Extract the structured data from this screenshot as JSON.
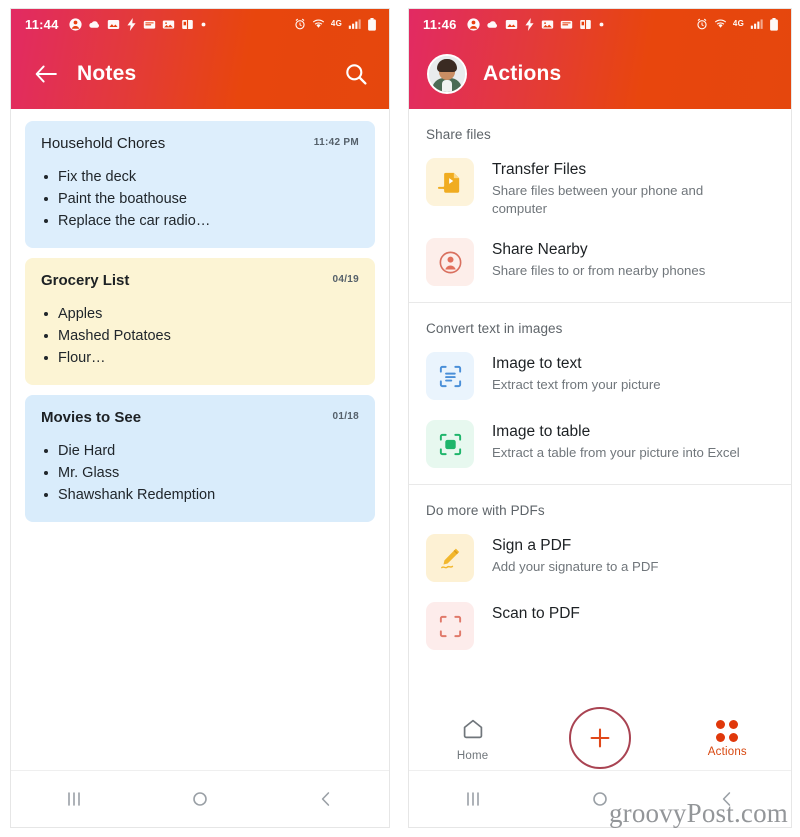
{
  "notes_panel": {
    "status_bar": {
      "clock": "11:44",
      "icons": [
        "account-icon",
        "weather-icon",
        "photos-icon",
        "flash-icon",
        "message-icon",
        "gallery-icon",
        "book-icon",
        "dot-icon"
      ],
      "right_icons": [
        "alarm-icon",
        "wifi-icon",
        "network-speed-icon",
        "signal-icon",
        "battery-icon"
      ]
    },
    "app_bar": {
      "back_label": "back-arrow",
      "title": "Notes",
      "search_label": "search"
    },
    "notes": [
      {
        "title": "Household Chores",
        "date": "11:42 PM",
        "bold": false,
        "bg": "#ddeefc",
        "items": [
          "Fix the deck",
          "Paint the boathouse",
          "Replace the car radio…"
        ]
      },
      {
        "title": "Grocery List",
        "date": "04/19",
        "bold": true,
        "bg": "#fcf4d4",
        "items": [
          "Apples",
          "Mashed Potatoes",
          "Flour…"
        ]
      },
      {
        "title": "Movies to See",
        "date": "01/18",
        "bold": true,
        "bg": "#d9ecfb",
        "items": [
          "Die Hard",
          "Mr. Glass",
          "Shawshank Redemption"
        ]
      }
    ]
  },
  "actions_panel": {
    "status_bar": {
      "clock": "11:46"
    },
    "app_bar": {
      "title": "Actions",
      "avatar_label": "user-avatar"
    },
    "sections": [
      {
        "title": "Share files",
        "rows": [
          {
            "icon": "transfer-files-icon",
            "icon_bg": "#fdf3da",
            "icon_fg": "#f2b028",
            "title": "Transfer Files",
            "subtitle": "Share files between your phone and computer"
          },
          {
            "icon": "share-nearby-icon",
            "icon_bg": "#fdeeea",
            "icon_fg": "#e0796a",
            "title": "Share Nearby",
            "subtitle": "Share files to or from nearby phones"
          }
        ]
      },
      {
        "title": "Convert text in images",
        "rows": [
          {
            "icon": "image-to-text-icon",
            "icon_bg": "#eaf4fd",
            "icon_fg": "#3f86d6",
            "title": "Image to text",
            "subtitle": "Extract text from your picture"
          },
          {
            "icon": "image-to-table-icon",
            "icon_bg": "#e7f8ef",
            "icon_fg": "#21b56a",
            "title": "Image to table",
            "subtitle": "Extract a table from your picture into Excel"
          }
        ]
      },
      {
        "title": "Do more with PDFs",
        "rows": [
          {
            "icon": "sign-pdf-icon",
            "icon_bg": "#fdf1d4",
            "icon_fg": "#f0b429",
            "title": "Sign a PDF",
            "subtitle": "Add your signature to a PDF"
          },
          {
            "icon": "scan-to-pdf-icon",
            "icon_bg": "#fdeceb",
            "icon_fg": "#e0796a",
            "title": "Scan to PDF",
            "subtitle": ""
          }
        ]
      }
    ],
    "bottom_nav": {
      "home_label": "Home",
      "add_label": "add",
      "actions_label": "Actions",
      "accent": "#e0380b"
    }
  },
  "system_nav": {
    "recents": "recents-button",
    "home": "home-button",
    "back": "back-button"
  },
  "watermark": "groovyPost.com"
}
